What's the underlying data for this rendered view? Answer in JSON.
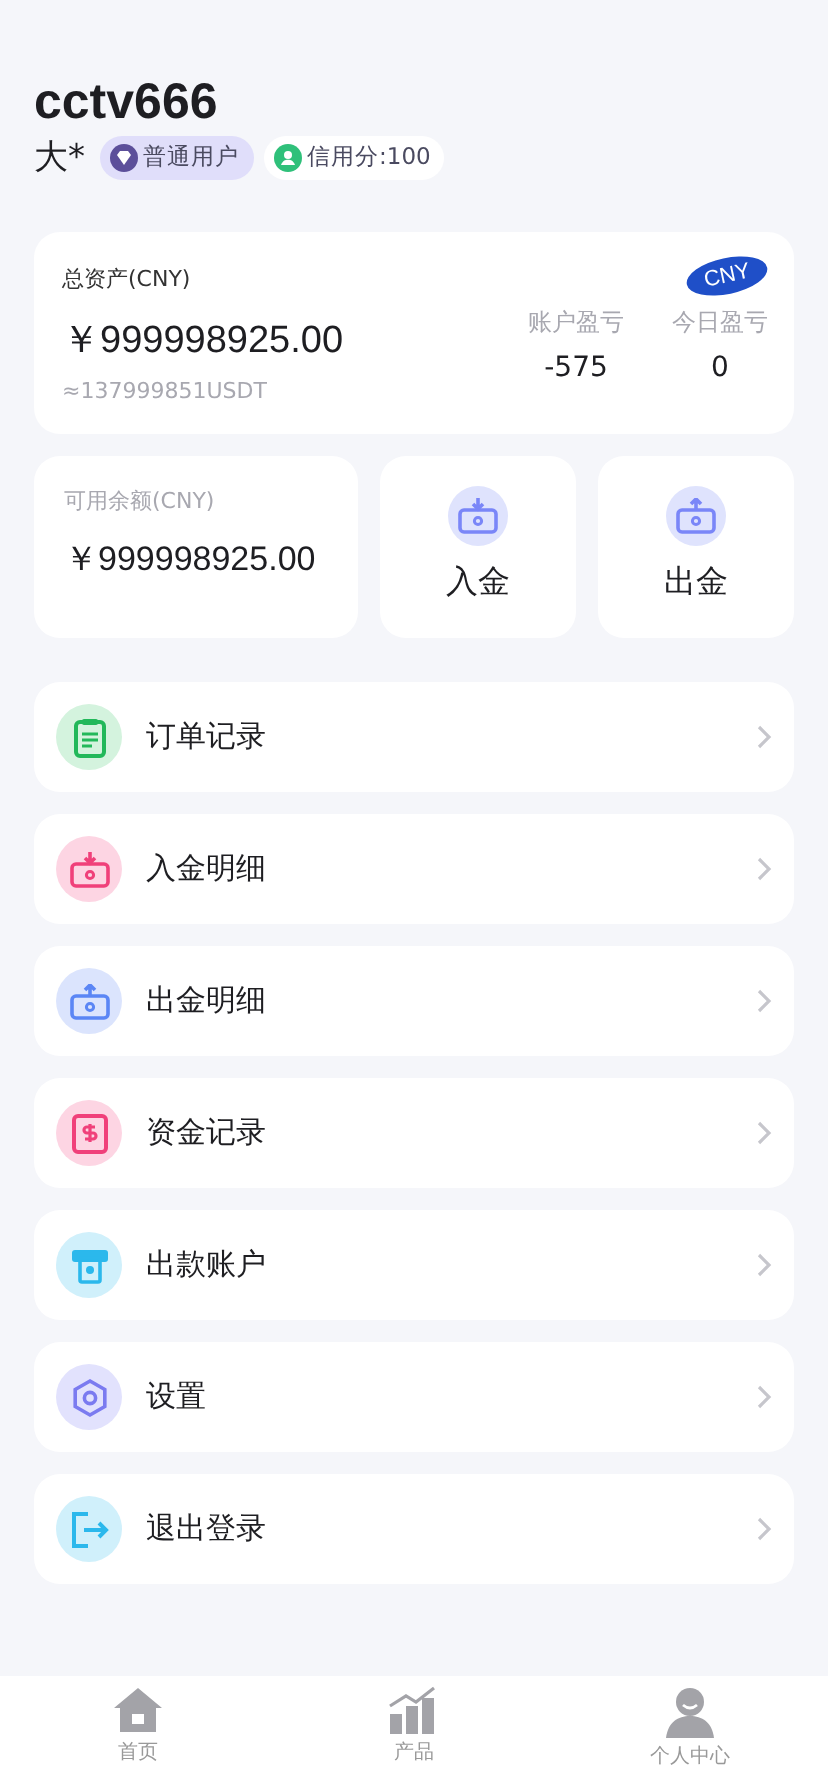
{
  "profile": {
    "username": "cctv666",
    "name": "大*",
    "level_badge": "普通用户",
    "credit": "信用分:100"
  },
  "assets": {
    "label": "总资产(CNY)",
    "currency": "CNY",
    "amount": "￥999998925.00",
    "usdt": "≈137999851USDT",
    "stats": [
      {
        "label": "账户盈亏",
        "value": "-575"
      },
      {
        "label": "今日盈亏",
        "value": "0"
      }
    ]
  },
  "balance": {
    "label": "可用余额(CNY)",
    "amount": "￥999998925.00"
  },
  "actions": [
    {
      "kind": "deposit",
      "label": "入金"
    },
    {
      "kind": "withdraw",
      "label": "出金"
    }
  ],
  "menu": [
    {
      "kind": "clipboard",
      "label": "订单记录",
      "color": "#22b85a"
    },
    {
      "kind": "deposit",
      "label": "入金明细",
      "color": "#f0407a"
    },
    {
      "kind": "withdraw",
      "label": "出金明细",
      "color": "#5b86f5"
    },
    {
      "kind": "funds",
      "label": "资金记录",
      "color": "#f0407a"
    },
    {
      "kind": "atm",
      "label": "出款账户",
      "color": "#2bb8ec"
    },
    {
      "kind": "settings",
      "label": "设置",
      "color": "#7b7bf0"
    },
    {
      "kind": "logout",
      "label": "退出登录",
      "color": "#2bb8ec"
    }
  ],
  "tabbar": [
    {
      "kind": "home",
      "label": "首页"
    },
    {
      "kind": "chart",
      "label": "产品"
    },
    {
      "kind": "person",
      "label": "个人中心"
    }
  ]
}
